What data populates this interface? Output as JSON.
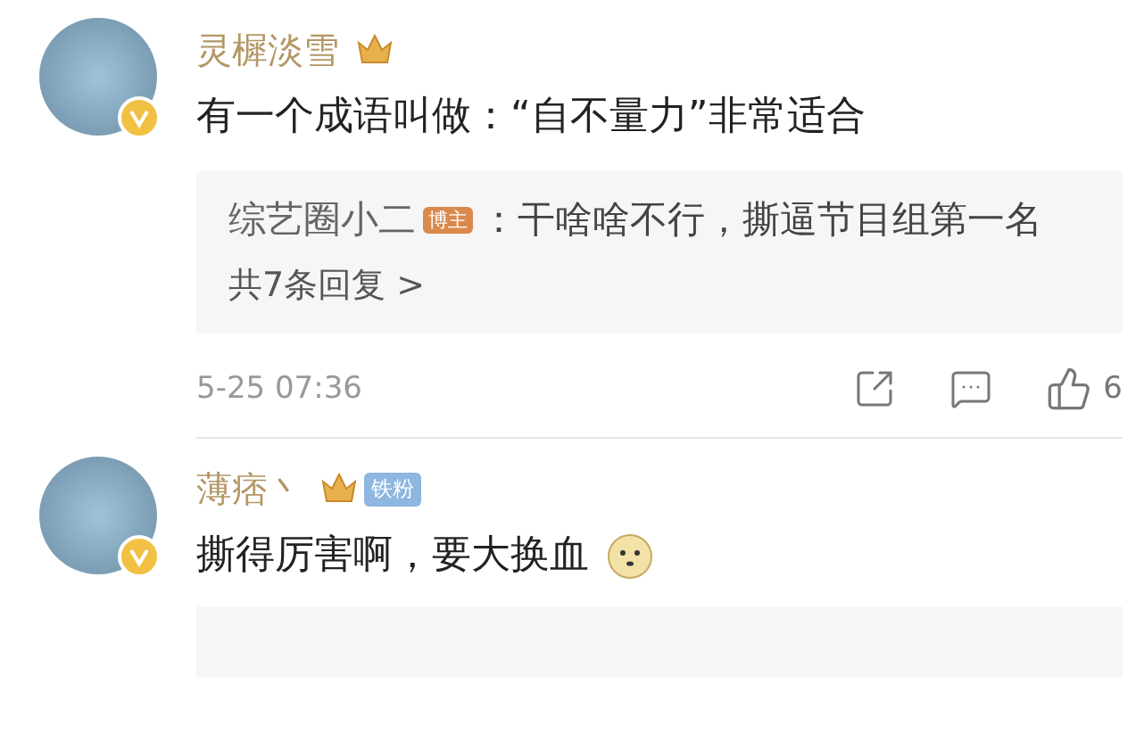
{
  "comments": [
    {
      "author": "灵樨淡雪",
      "crown": true,
      "verified": true,
      "text": "有一个成语叫做：“自不量力”非常适合",
      "emoji": false,
      "reply": {
        "author": "综艺圈小二",
        "tag": "博主",
        "text": "：干啥啥不行，撕逼节目组第一名",
        "more": "共7条回复 >"
      },
      "reply_partial": false,
      "time": "5-25 07:36",
      "likes": "6"
    },
    {
      "author": "薄痞丶",
      "crown": true,
      "fan_tag": "铁粉",
      "verified": true,
      "text": "撕得厉害啊，要大换血",
      "emoji": true,
      "reply_partial": true
    }
  ]
}
